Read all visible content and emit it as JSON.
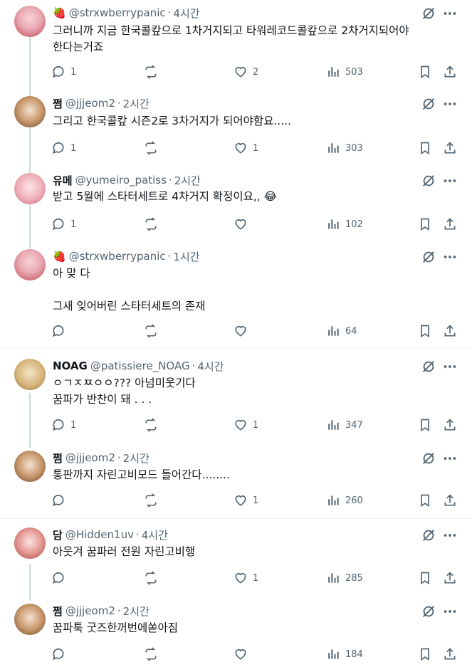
{
  "tweets": [
    {
      "name": "🍓",
      "handle": "@strxwberrypanic",
      "time": "4시간",
      "text": "그러니까 지금 한국콜캎으로 1차거지되고 타워레코드콜캎으로 2차거지되어야\n한다는거죠",
      "replies": "1",
      "retweets": "",
      "likes": "2",
      "views": "503"
    },
    {
      "name": "쩜",
      "handle": "@jjjeom2",
      "time": "2시간",
      "text": "그리고 한국콜캎 시즌2로 3차거지가 되어야함요.....",
      "replies": "1",
      "retweets": "",
      "likes": "1",
      "views": "303"
    },
    {
      "name": "유메",
      "handle": "@yumeiro_patiss",
      "time": "2시간",
      "text": "받고 5월에 스타터세트로 4차거지 확정이요,, 😂",
      "replies": "1",
      "retweets": "",
      "likes": "",
      "views": "102"
    },
    {
      "name": "🍓",
      "handle": "@strxwberrypanic",
      "time": "1시간",
      "text": "아 맞 다\n\n그새 잊어버린 스타터세트의 존재",
      "replies": "",
      "retweets": "",
      "likes": "",
      "views": "64"
    },
    {
      "name": "NOAG",
      "handle": "@patissiere_NOAG",
      "time": "4시간",
      "text": "ㅇㄱㅈㅉㅇㅇ??? 아넘미웃기다\n꿈파가 반찬이 돼 . . .",
      "replies": "1",
      "retweets": "",
      "likes": "1",
      "views": "347"
    },
    {
      "name": "쩜",
      "handle": "@jjjeom2",
      "time": "2시간",
      "text": "통판까지 자린고비모드 들어간다........",
      "replies": "",
      "retweets": "",
      "likes": "1",
      "views": "260"
    },
    {
      "name": "담",
      "handle": "@Hidden1uv",
      "time": "4시간",
      "text": "아웃겨 꿈파러 전원 자린고비행",
      "replies": "",
      "retweets": "",
      "likes": "1",
      "views": "285"
    },
    {
      "name": "쩜",
      "handle": "@jjjeom2",
      "time": "2시간",
      "text": "꿈파툭 굿즈한꺼번에쏟아짐",
      "replies": "",
      "retweets": "",
      "likes": "",
      "views": "184"
    }
  ],
  "icons": {
    "reply": "reply-icon",
    "retweet": "retweet-icon",
    "like": "heart-icon",
    "views": "views-icon",
    "bookmark": "bookmark-icon",
    "share": "share-icon",
    "grok": "grok-icon",
    "more": "more-icon"
  },
  "colors": {
    "text": "#0f1419",
    "secondary": "#536471",
    "thread_line": "#cfd9de",
    "divider": "#eff3f4"
  }
}
